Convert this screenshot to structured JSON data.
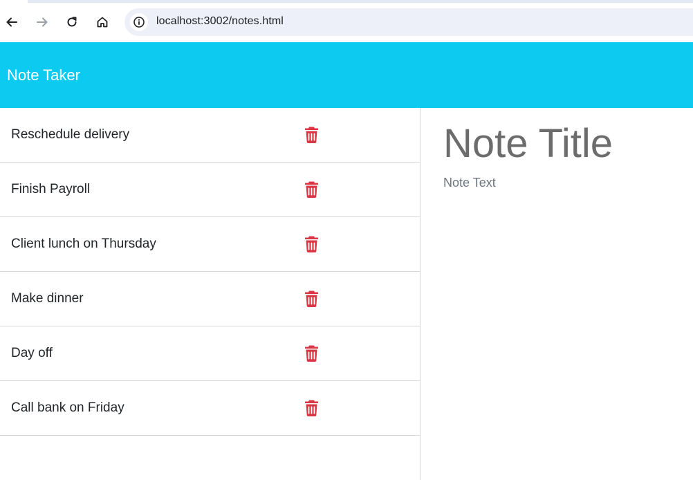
{
  "browser": {
    "url": "localhost:3002/notes.html",
    "icons": {
      "back": "arrow-left-icon",
      "forward": "arrow-right-icon",
      "reload": "reload-icon",
      "home": "home-icon",
      "info": "info-icon"
    }
  },
  "header": {
    "title": "Note Taker",
    "color": "#0dcaf0"
  },
  "notes": [
    {
      "label": "Reschedule delivery"
    },
    {
      "label": "Finish Payroll"
    },
    {
      "label": "Client lunch on Thursday"
    },
    {
      "label": "Make dinner"
    },
    {
      "label": "Day off"
    },
    {
      "label": "Call bank on Friday"
    }
  ],
  "editor": {
    "title_placeholder": "Note Title",
    "text_placeholder": "Note Text"
  },
  "colors": {
    "delete": "#dc3545"
  }
}
